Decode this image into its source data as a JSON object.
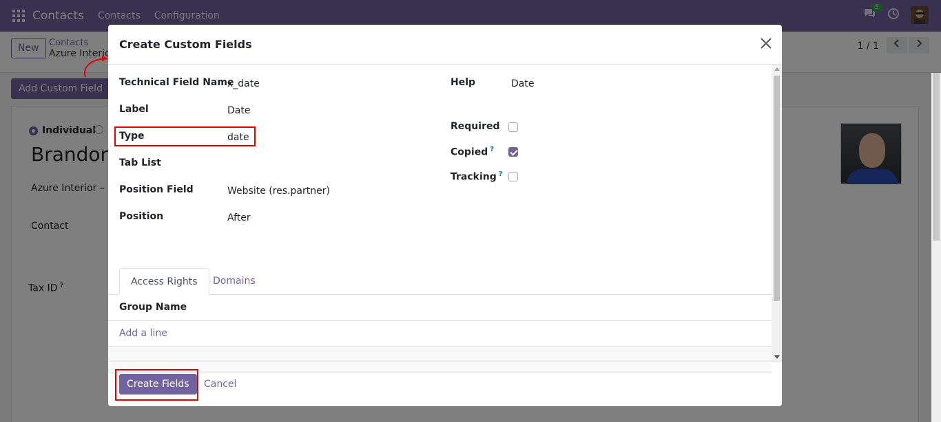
{
  "navbar": {
    "app_name": "Contacts",
    "menu": [
      "Contacts",
      "Configuration"
    ],
    "message_count": "5",
    "icons": [
      "apps-icon",
      "chat-icon",
      "clock-icon",
      "avatar"
    ]
  },
  "control": {
    "new_label": "New",
    "breadcrumb_parent": "Contacts",
    "breadcrumb_current": "Azure Interior",
    "pager": "1 / 1"
  },
  "background_form": {
    "add_custom_field_label": "Add Custom Field",
    "radio_individual": "Individual",
    "name": "Brandon",
    "company": "Azure Interior – U",
    "contact_label": "Contact",
    "tax_label": "Tax ID"
  },
  "modal": {
    "title": "Create Custom Fields",
    "fields_left": [
      {
        "label": "Technical Field Name",
        "value": "x_date"
      },
      {
        "label": "Label",
        "value": "Date"
      },
      {
        "label": "Type",
        "value": "date"
      },
      {
        "label": "Tab List",
        "value": ""
      },
      {
        "label": "Position Field",
        "value": "Website (res.partner)"
      },
      {
        "label": "Position",
        "value": "After"
      }
    ],
    "help": {
      "label": "Help",
      "value": "Date"
    },
    "checks": [
      {
        "label": "Required",
        "checked": false,
        "has_help": false
      },
      {
        "label": "Copied",
        "checked": true,
        "has_help": true
      },
      {
        "label": "Tracking",
        "checked": false,
        "has_help": true
      }
    ],
    "help_mark": "?",
    "tabs": [
      "Access Rights",
      "Domains"
    ],
    "table_header": "Group Name",
    "add_line": "Add a line",
    "create_button": "Create Fields",
    "cancel_button": "Cancel"
  },
  "colors": {
    "brand": "#71639e",
    "highlight": "#e60000",
    "link": "#71639e",
    "help_mark": "#017e84"
  }
}
